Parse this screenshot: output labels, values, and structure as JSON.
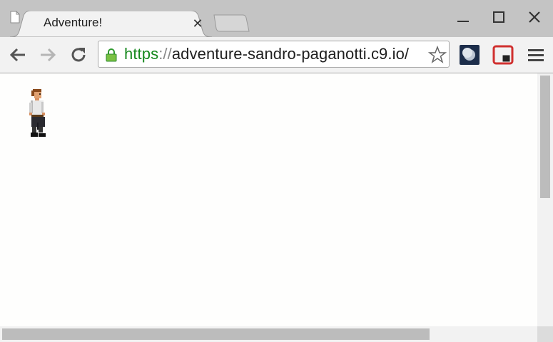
{
  "window": {
    "controls": {
      "minimize_icon": "minimize-icon",
      "maximize_icon": "maximize-icon",
      "close_icon": "close-icon"
    }
  },
  "tab": {
    "title": "Adventure!",
    "close_glyph": "✕",
    "icon": "document-icon"
  },
  "toolbar": {
    "back_icon": "back-arrow-icon",
    "forward_icon": "forward-arrow-icon",
    "reload_icon": "reload-icon",
    "url": {
      "scheme": "https",
      "separator": "://",
      "host": "adventure-sandro-paganotti.c9.io/"
    },
    "secure_icon": "lock-icon",
    "bookmark_icon": "star-icon",
    "extensions": [
      "moon-extension-icon",
      "screen-capture-extension-icon"
    ],
    "menu_icon": "hamburger-menu-icon"
  },
  "page": {
    "character": "adventurer-sprite"
  },
  "colors": {
    "scheme_green": "#16891e",
    "page_background": "#fefefd",
    "chrome_frame": "#c4c4c4"
  }
}
